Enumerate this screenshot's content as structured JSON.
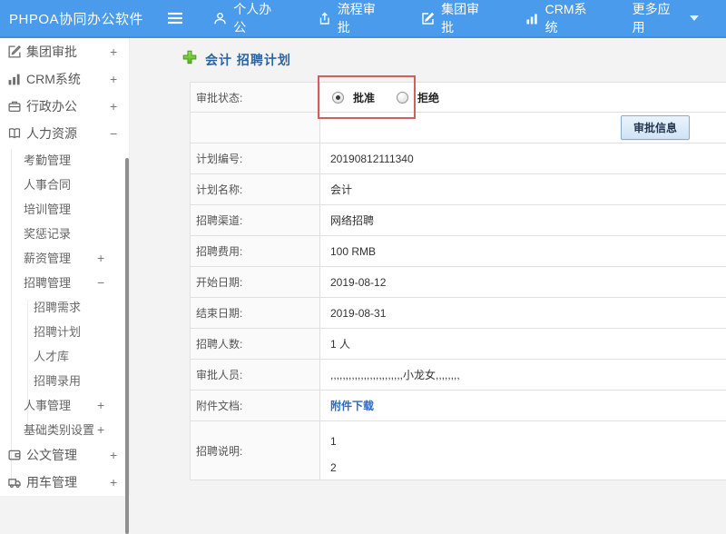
{
  "navbar": {
    "brand": "PHPOA协同办公软件",
    "items": [
      {
        "label": "个人办公",
        "icon": "user-icon"
      },
      {
        "label": "流程审批",
        "icon": "flow-export-icon"
      },
      {
        "label": "集团审批",
        "icon": "edit-square-icon"
      },
      {
        "label": "CRM系统",
        "icon": "bar-chart-icon"
      },
      {
        "label": "更多应用",
        "icon": "caret-down-icon"
      }
    ]
  },
  "sidebar": {
    "items": [
      {
        "label": "集团审批",
        "expander": "+",
        "level": 1,
        "icon": "edit-square-icon"
      },
      {
        "label": "CRM系统",
        "expander": "+",
        "level": 1,
        "icon": "bar-chart-icon"
      },
      {
        "label": "行政办公",
        "expander": "+",
        "level": 1,
        "icon": "briefcase-icon"
      },
      {
        "label": "人力资源",
        "expander": "−",
        "level": 1,
        "icon": "book-icon"
      },
      {
        "label": "考勤管理",
        "level": 2
      },
      {
        "label": "人事合同",
        "level": 2
      },
      {
        "label": "培训管理",
        "level": 2
      },
      {
        "label": "奖惩记录",
        "level": 2
      },
      {
        "label": "薪资管理",
        "expander": "+",
        "level": 2
      },
      {
        "label": "招聘管理",
        "expander": "−",
        "level": 2
      },
      {
        "label": "招聘需求",
        "level": 3
      },
      {
        "label": "招聘计划",
        "level": 3
      },
      {
        "label": "人才库",
        "level": 3
      },
      {
        "label": "招聘录用",
        "level": 3
      },
      {
        "label": "人事管理",
        "expander": "+",
        "level": 2
      },
      {
        "label": "基础类别设置",
        "expander": "+",
        "level": 2
      },
      {
        "label": "公文管理",
        "expander": "+",
        "level": 1,
        "icon": "document-icon"
      },
      {
        "label": "用车管理",
        "expander": "+",
        "level": 1,
        "icon": "truck-icon"
      }
    ]
  },
  "main": {
    "title": "会计 招聘计划",
    "approval": {
      "label": "审批状态:",
      "options": [
        {
          "label": "批准",
          "checked": true
        },
        {
          "label": "拒绝",
          "checked": false
        }
      ]
    },
    "approve_button": "审批信息",
    "fields": [
      {
        "label": "计划编号:",
        "value": "20190812111340"
      },
      {
        "label": "计划名称:",
        "value": "会计"
      },
      {
        "label": "招聘渠道:",
        "value": "网络招聘"
      },
      {
        "label": "招聘费用:",
        "value": "100 RMB"
      },
      {
        "label": "开始日期:",
        "value": "2019-08-12"
      },
      {
        "label": "结束日期:",
        "value": "2019-08-31"
      },
      {
        "label": "招聘人数:",
        "value": "1 人"
      },
      {
        "label": "审批人员:",
        "value": ",,,,,,,,,,,,,,,,,,,,,,,,小龙女,,,,,,,,"
      },
      {
        "label": "附件文档:",
        "value": "附件下载"
      },
      {
        "label": "招聘说明:",
        "lines": [
          "1",
          "2"
        ]
      }
    ]
  },
  "colors": {
    "navbar_blue": "#4a9bec",
    "title_blue": "#2e64a0",
    "link_blue": "#2a6bc5",
    "annotation_red": "#d06060",
    "label_bg": "#fafafa",
    "main_bg": "#f3f3f3"
  }
}
